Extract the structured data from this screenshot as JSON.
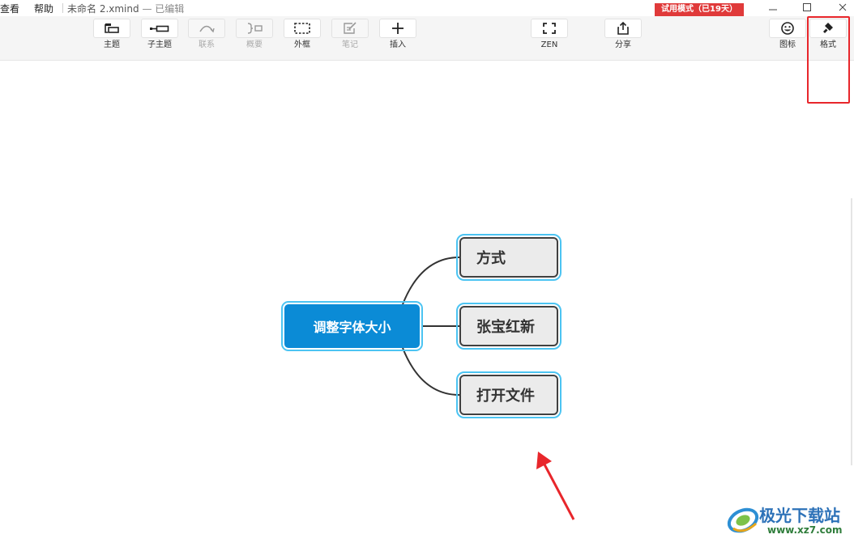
{
  "menubar": {
    "items": [
      "查看",
      "帮助"
    ],
    "document_title": "未命名 2.xmind",
    "document_status": "— 已编辑"
  },
  "trial_badge": "试用模式（已19天）",
  "toolbar": {
    "tools": [
      {
        "label": "主题",
        "icon": "topic-icon",
        "enabled": true
      },
      {
        "label": "子主题",
        "icon": "subtopic-icon",
        "enabled": true
      },
      {
        "label": "联系",
        "icon": "relationship-icon",
        "enabled": false
      },
      {
        "label": "概要",
        "icon": "summary-icon",
        "enabled": false
      },
      {
        "label": "外框",
        "icon": "boundary-icon",
        "enabled": true
      },
      {
        "label": "笔记",
        "icon": "note-icon",
        "enabled": false
      },
      {
        "label": "插入",
        "icon": "plus-icon",
        "enabled": true
      },
      {
        "label": "ZEN",
        "icon": "zen-mode-icon",
        "enabled": true
      },
      {
        "label": "分享",
        "icon": "share-icon",
        "enabled": true
      },
      {
        "label": "图标",
        "icon": "smiley-icon",
        "enabled": true
      },
      {
        "label": "格式",
        "icon": "format-brush-icon",
        "enabled": true
      }
    ]
  },
  "mindmap": {
    "central_topic": "调整字体大小",
    "subtopics": [
      "方式",
      "张宝红新",
      "打开文件"
    ]
  },
  "colors": {
    "central_fill": "#0b8bd6",
    "selection_outline": "#4cc4f2",
    "subtopic_fill": "#ebebeb",
    "annotation_red": "#e8262b",
    "trial_red": "#e03a3a"
  },
  "watermark": {
    "name": "极光下载站",
    "url": "www.xz7.com"
  }
}
